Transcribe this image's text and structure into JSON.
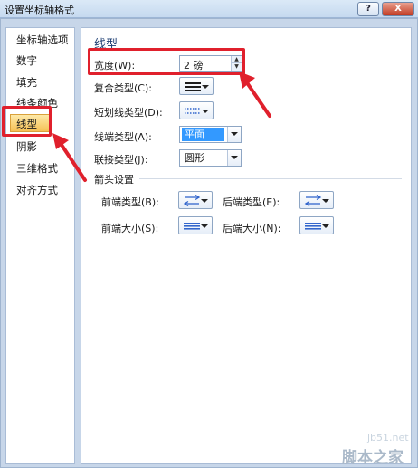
{
  "window": {
    "title": "设置坐标轴格式",
    "help_label": "?",
    "close_label": "X"
  },
  "sidebar": {
    "items": [
      {
        "label": "坐标轴选项"
      },
      {
        "label": "数字"
      },
      {
        "label": "填充"
      },
      {
        "label": "线条颜色"
      },
      {
        "label": "线型",
        "selected": true
      },
      {
        "label": "阴影"
      },
      {
        "label": "三维格式"
      },
      {
        "label": "对齐方式"
      }
    ]
  },
  "panel": {
    "title": "线型",
    "width_label": "宽度(W):",
    "width_value": "2 磅",
    "compound_label": "复合类型(C):",
    "dash_label": "短划线类型(D):",
    "cap_label": "线端类型(A):",
    "cap_value": "平面",
    "join_label": "联接类型(J):",
    "join_value": "圆形",
    "arrow_section": "箭头设置",
    "begin_type_label": "前端类型(B):",
    "end_type_label": "后端类型(E):",
    "begin_size_label": "前端大小(S):",
    "end_size_label": "后端大小(N):"
  },
  "colors": {
    "highlight": "#e0202c",
    "selection": "#3399ff",
    "frame": "#c7d6e9"
  },
  "watermark": {
    "url": "jb51.net",
    "name": "脚本之家"
  }
}
